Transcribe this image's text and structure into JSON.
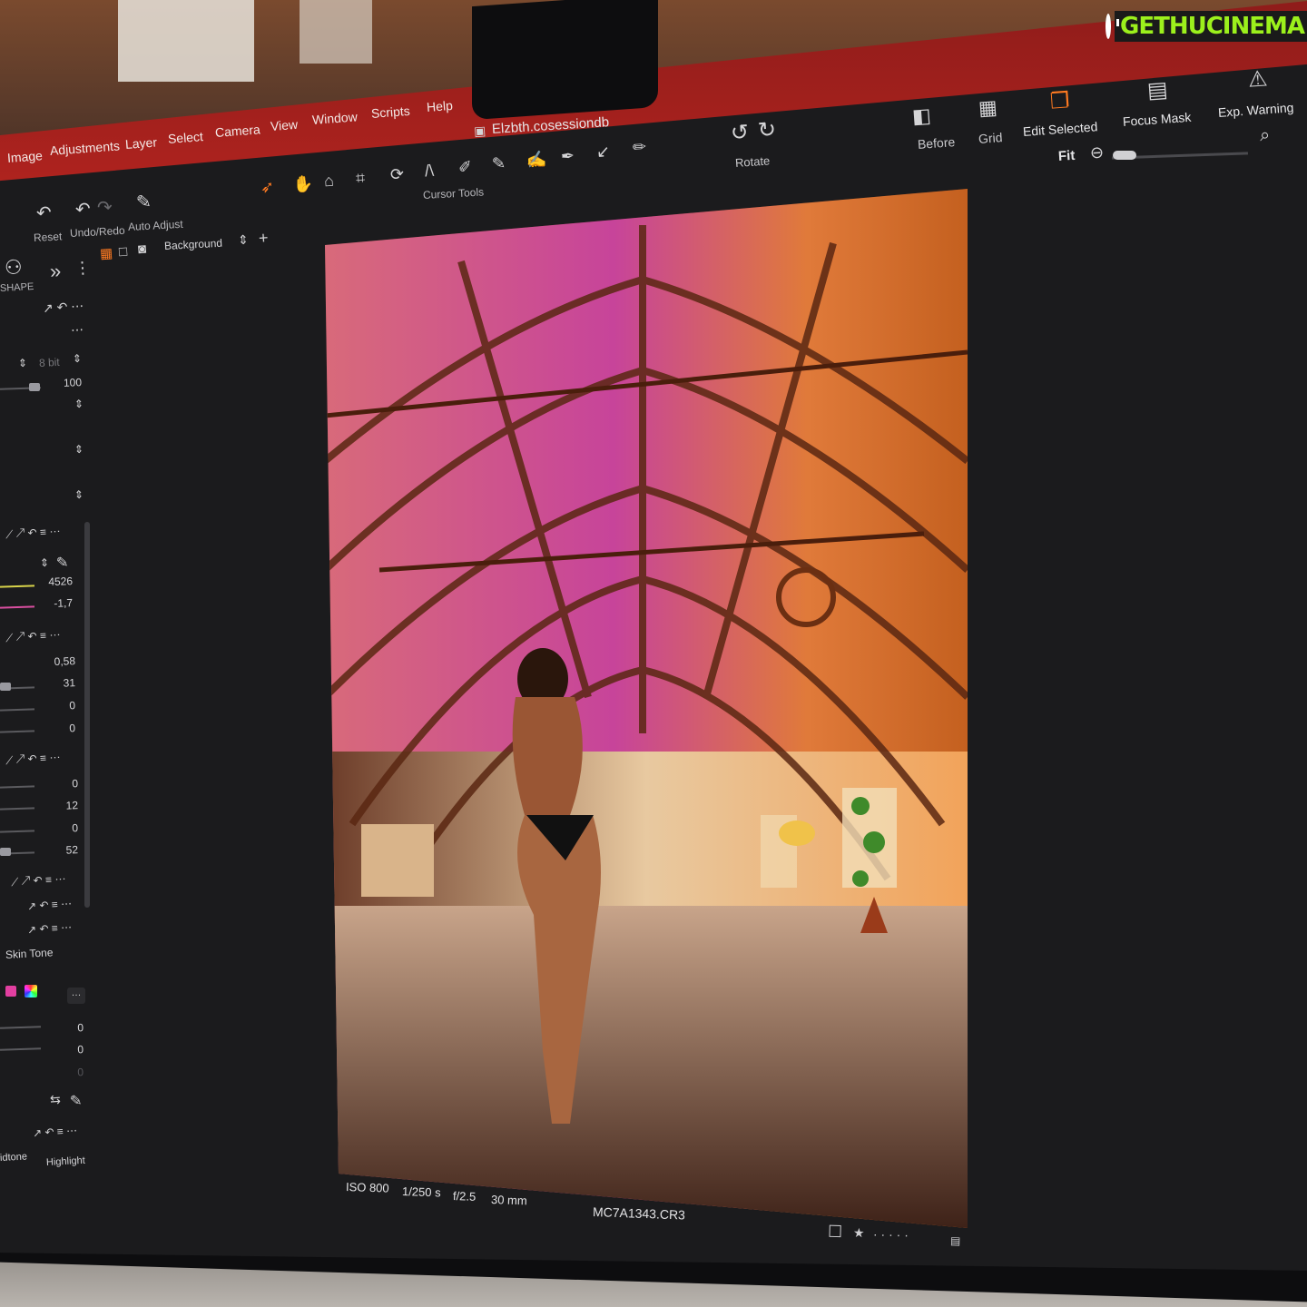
{
  "watermark": {
    "text": "GETHUCINEMA"
  },
  "menu": {
    "items": [
      "Image",
      "Adjustments",
      "Layer",
      "Select",
      "Camera",
      "View",
      "Window",
      "Scripts",
      "Help"
    ]
  },
  "document": {
    "title": "Elzbth.cosessiondb"
  },
  "toolbar": {
    "reset_label": "Reset",
    "undo_redo_label": "Undo/Redo",
    "auto_adjust_label": "Auto Adjust",
    "cursor_tools_label": "Cursor Tools",
    "rotate_label": "Rotate",
    "before_label": "Before",
    "grid_label": "Grid",
    "edit_selected_label": "Edit Selected",
    "focus_mask_label": "Focus Mask",
    "exp_warning_label": "Exp. Warning",
    "fit_label": "Fit"
  },
  "layer": {
    "selected": "Background"
  },
  "sidebar": {
    "shape_label": "SHAPE",
    "bit_depth": "8 bit",
    "value_100": "100",
    "white_balance": {
      "kelvin": "4526",
      "tint": "-1,7"
    },
    "exposure": {
      "values": [
        "0,58",
        "31",
        "0",
        "0"
      ]
    },
    "hdr": {
      "values": [
        "0",
        "12",
        "0",
        "52"
      ]
    },
    "skin_tone_label": "Skin Tone",
    "skin_values": [
      "0",
      "0",
      "0"
    ],
    "tone_tabs": [
      "idtone",
      "Highlight"
    ]
  },
  "photo_info": {
    "iso": "ISO 800",
    "shutter": "1/250 s",
    "aperture": "f/2.5",
    "focal": "30 mm",
    "filename": "MC7A1343.CR3"
  },
  "colors": {
    "accent": "#ff7a21",
    "menubar": "#b3241f",
    "watermark_green": "#9cf01c"
  },
  "icons": [
    "clock-icon",
    "reset-icon",
    "undo-icon",
    "redo-icon",
    "auto-adjust-icon",
    "pointer-icon",
    "hand-icon",
    "crop-icon",
    "rotate-icon",
    "brush-icon",
    "eraser-icon",
    "picker-icon",
    "before-icon",
    "grid-icon",
    "edit-selected-icon",
    "focus-mask-icon",
    "warning-icon",
    "search-icon",
    "star-icon"
  ]
}
